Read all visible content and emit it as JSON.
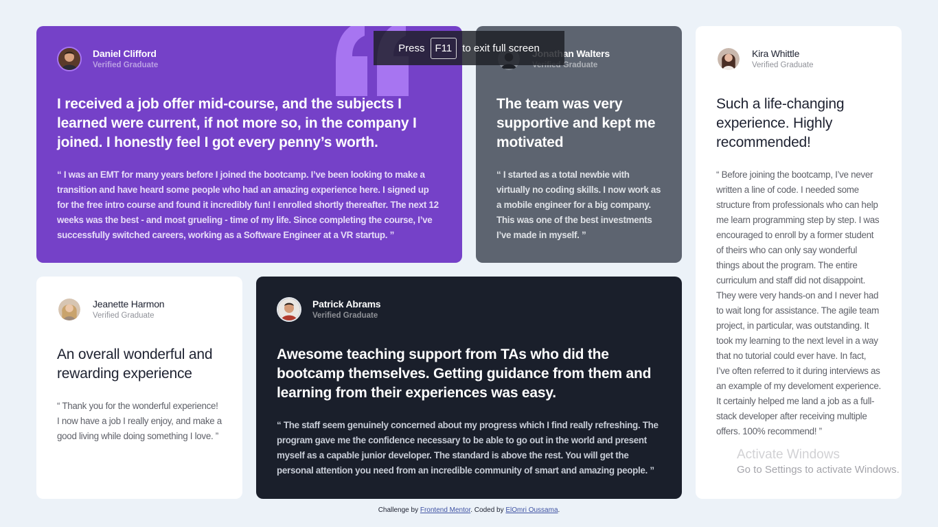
{
  "colors": {
    "page_bg": "#ecf2f8",
    "purple": "#7541c8",
    "gray": "#5d6470",
    "dark": "#1a1f2b",
    "white": "#ffffff",
    "quote_mark": "#a775f1"
  },
  "testimonials": [
    {
      "name": "Daniel Clifford",
      "status": "Verified Graduate",
      "headline": "I received a job offer mid-course, and the subjects I learned were current, if not more so, in the company I joined. I honestly feel I got every penny’s worth.",
      "body": "“ I was an EMT for many years before I joined the bootcamp. I’ve been looking to make a transition and have heard some people who had an amazing experience here. I signed up for the free intro course and found it incredibly fun! I enrolled shortly thereafter. The next 12 weeks was the best - and most grueling - time of my life. Since completing the course, I’ve successfully switched careers, working as a Software Engineer at a VR startup. ”"
    },
    {
      "name": "Jonathan Walters",
      "status": "Verified Graduate",
      "headline": "The team was very supportive and kept me motivated",
      "body": "“ I started as a total newbie with virtually no coding skills. I now work as a mobile engineer for a big company. This was one of the best investments I’ve made in myself. ”"
    },
    {
      "name": "Kira Whittle",
      "status": "Verified Graduate",
      "headline": "Such a life-changing experience. Highly recommended!",
      "body": "“ Before joining the bootcamp, I’ve never written a line of code. I needed some structure from professionals who can help me learn programming step by step. I was encouraged to enroll by a former student of theirs who can only say wonderful things about the program. The entire curriculum and staff did not disappoint. They were very hands-on and I never had to wait long for assistance. The agile team project, in particular, was outstanding. It took my learning to the next level in a way that no tutorial could ever have. In fact, I’ve often referred to it during interviews as an example of my develoment experience. It certainly helped me land a job as a full-stack developer after receiving multiple offers. 100% recommend! ”"
    },
    {
      "name": "Jeanette Harmon",
      "status": "Verified Graduate",
      "headline": "An overall wonderful and rewarding experience",
      "body": "“ Thank you for the wonderful experience! I now have a job I really enjoy, and make a good living while doing something I love. ”"
    },
    {
      "name": "Patrick Abrams",
      "status": "Verified Graduate",
      "headline": "Awesome teaching support from TAs who did the bootcamp themselves. Getting guidance from them and learning from their experiences was easy.",
      "body": "“ The staff seem genuinely concerned about my progress which I find really refreshing. The program gave me the confidence necessary to be able to go out in the world and present myself as a capable junior developer. The standard is above the rest. You will get the personal attention you need from an incredible community of smart and amazing people. ”"
    }
  ],
  "footer": {
    "prefix": "Challenge by ",
    "link1": "Frontend Mentor",
    "middle": ". Coded by ",
    "link2": "ElOmri Oussama",
    "suffix": "."
  },
  "fullscreen_toast": {
    "before": "Press",
    "key": "F11",
    "after": "to exit full screen"
  },
  "watermark": {
    "title": "Activate Windows",
    "subtitle": "Go to Settings to activate Windows."
  }
}
